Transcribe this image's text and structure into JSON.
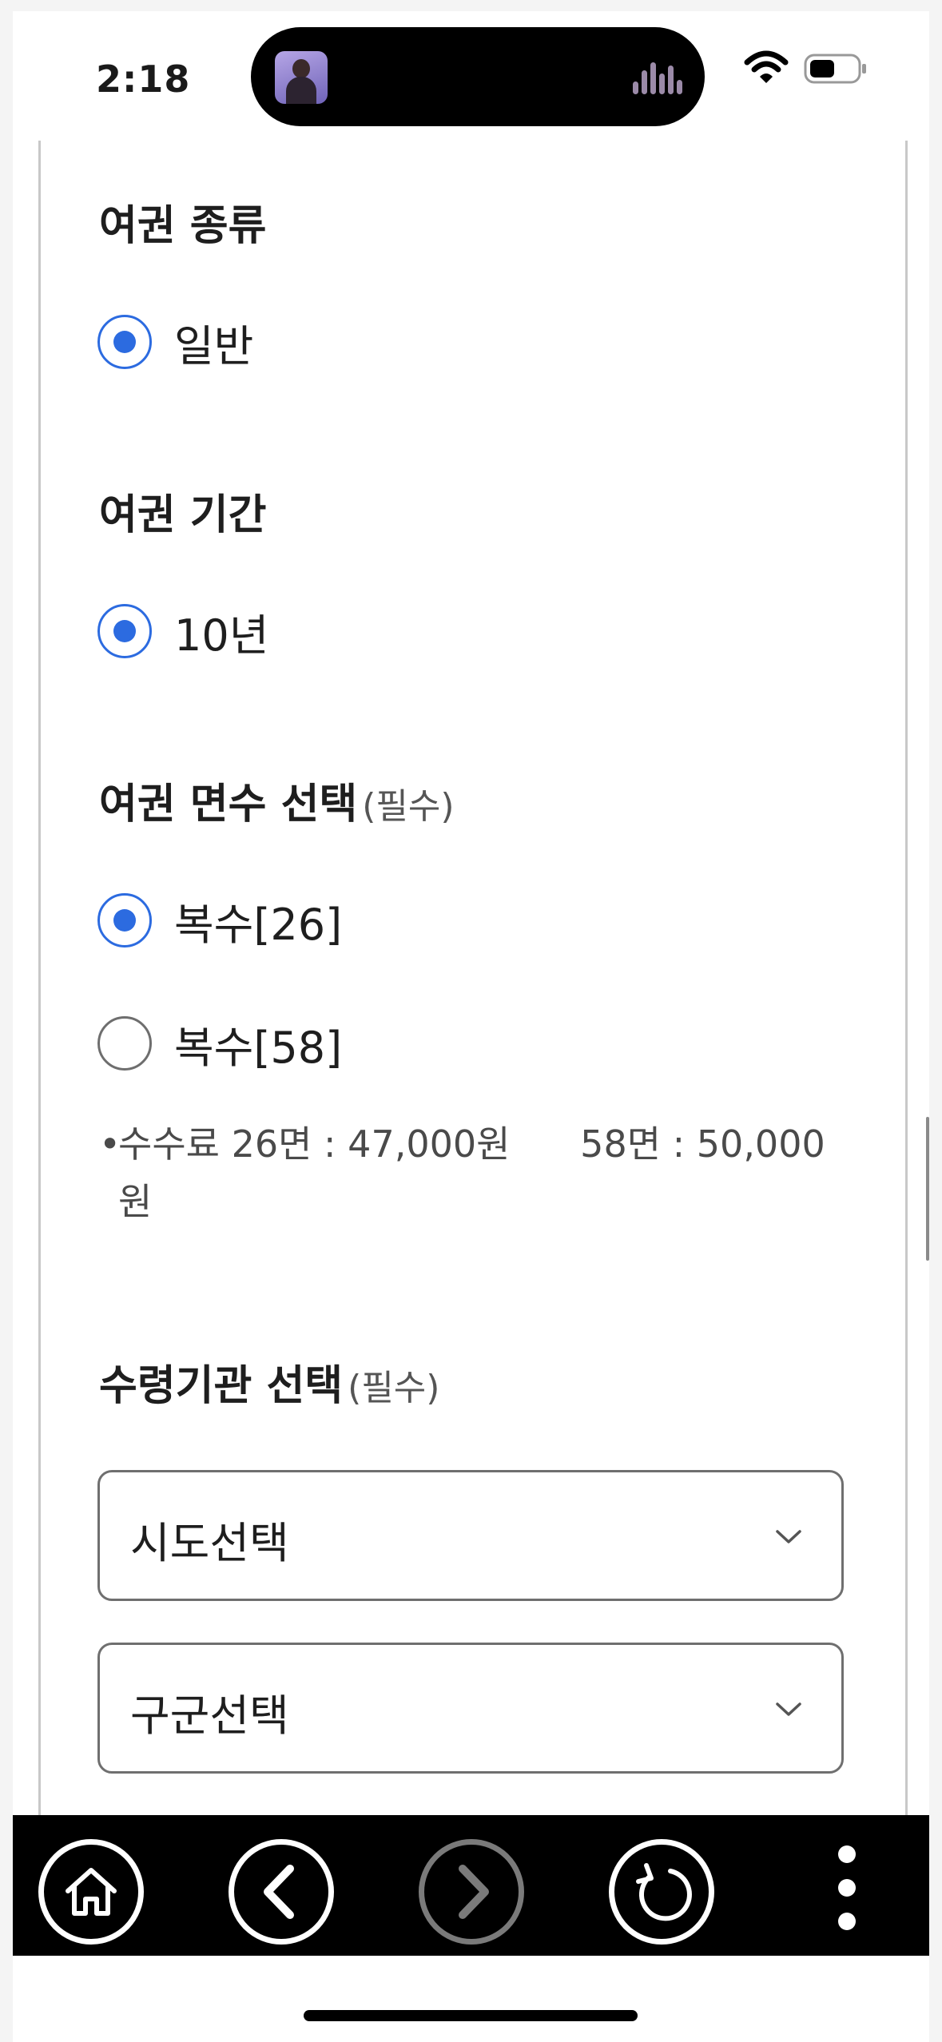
{
  "status_bar": {
    "time": "2:18"
  },
  "sections": {
    "passport_type": {
      "title": "여권 종류",
      "options": [
        {
          "label": "일반",
          "checked": true
        }
      ]
    },
    "passport_period": {
      "title": "여권 기간",
      "options": [
        {
          "label": "10년",
          "checked": true
        }
      ]
    },
    "page_count": {
      "title": "여권 면수 선택",
      "required": "(필수)",
      "options": [
        {
          "label": "복수[26]",
          "checked": true
        },
        {
          "label": "복수[58]",
          "checked": false
        }
      ],
      "note": "수수료 26면 : 47,000원      58면 : 50,000\n원"
    },
    "office": {
      "title": "수령기관 선택",
      "required": "(필수)",
      "province_select": "시도선택",
      "district_select": "구군선택"
    }
  },
  "colors": {
    "accent": "#2c6be0",
    "toolbar": "#000000",
    "border": "#6f6f6f"
  },
  "toolbar_icons": [
    "home-icon",
    "back-icon",
    "forward-icon",
    "refresh-icon",
    "more-icon"
  ]
}
